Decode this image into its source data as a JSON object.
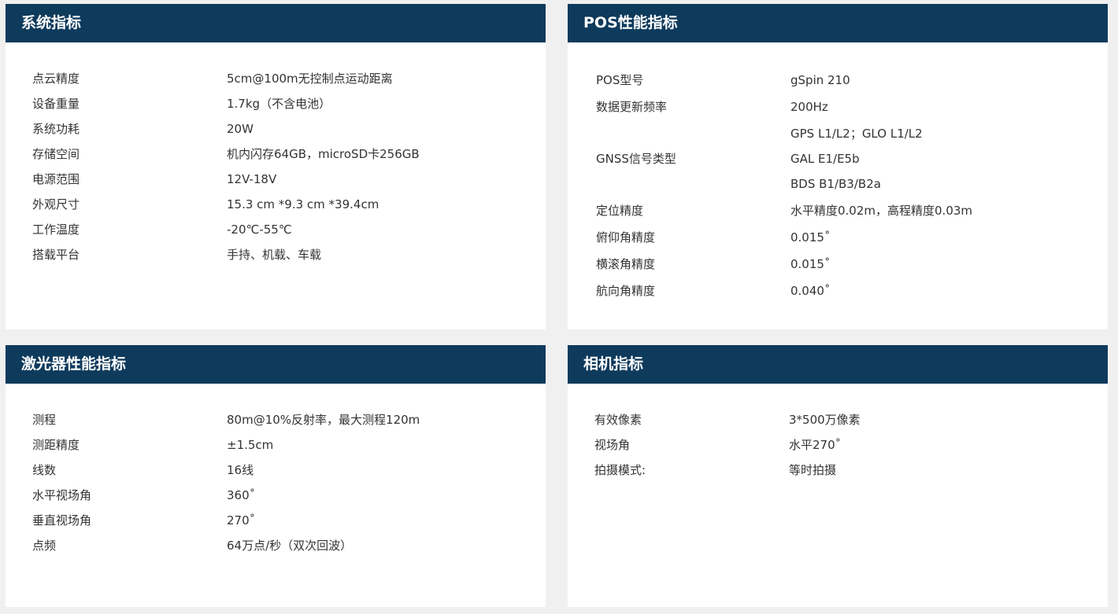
{
  "system": {
    "title": "系统指标",
    "rows": [
      {
        "label": "点云精度",
        "value": "5cm@100m无控制点运动距离"
      },
      {
        "label": "设备重量",
        "value": "1.7kg（不含电池）"
      },
      {
        "label": "系统功耗",
        "value": "20W"
      },
      {
        "label": "存储空间",
        "value": "机内闪存64GB，microSD卡256GB"
      },
      {
        "label": "电源范围",
        "value": "12V-18V"
      },
      {
        "label": "外观尺寸",
        "value": "15.3 cm *9.3 cm *39.4cm"
      },
      {
        "label": "工作温度",
        "value": "-20℃-55℃"
      },
      {
        "label": "搭载平台",
        "value": "手持、机载、车载"
      }
    ]
  },
  "pos": {
    "title": "POS性能指标",
    "rows": [
      {
        "label": "POS型号",
        "value": "gSpin 210"
      },
      {
        "label": "数据更新频率",
        "value": "200Hz"
      },
      {
        "label": "",
        "value": "GPS L1/L2；GLO L1/L2"
      },
      {
        "label": "GNSS信号类型",
        "value": "GAL E1/E5b"
      },
      {
        "label": "",
        "value": "BDS B1/B3/B2a"
      },
      {
        "label": "定位精度",
        "value": "水平精度0.02m，高程精度0.03m"
      },
      {
        "label": "俯仰角精度",
        "value": "0.015˚"
      },
      {
        "label": "横滚角精度",
        "value": "0.015˚"
      },
      {
        "label": "航向角精度",
        "value": "0.040˚"
      }
    ]
  },
  "laser": {
    "title": "激光器性能指标",
    "rows": [
      {
        "label": "测程",
        "value": "80m@10%反射率，最大测程120m"
      },
      {
        "label": "测距精度",
        "value": "±1.5cm"
      },
      {
        "label": "线数",
        "value": "16线"
      },
      {
        "label": "水平视场角",
        "value": "360˚"
      },
      {
        "label": "垂直视场角",
        "value": "270˚"
      },
      {
        "label": "点频",
        "value": "64万点/秒（双次回波）"
      }
    ]
  },
  "camera": {
    "title": "相机指标",
    "rows": [
      {
        "label": "有效像素",
        "value": "3*500万像素"
      },
      {
        "label": "视场角",
        "value": "水平270˚"
      },
      {
        "label": "拍摄模式:",
        "value": "等时拍摄"
      }
    ]
  }
}
